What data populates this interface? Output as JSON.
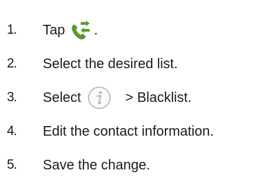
{
  "steps": [
    {
      "number": "1.",
      "text_before": "Tap",
      "text_after": ".",
      "icon": "phone-arrows-icon"
    },
    {
      "number": "2.",
      "text": "Select the desired list."
    },
    {
      "number": "3.",
      "text_before": "Select",
      "text_after": "> Blacklist.",
      "icon": "info-icon"
    },
    {
      "number": "4.",
      "text": "Edit the contact information."
    },
    {
      "number": "5.",
      "text": "Save the change."
    }
  ],
  "colors": {
    "text": "#1a1a1a",
    "phone_icon": "#5a9a2e",
    "info_icon": "#b5b5b5"
  }
}
